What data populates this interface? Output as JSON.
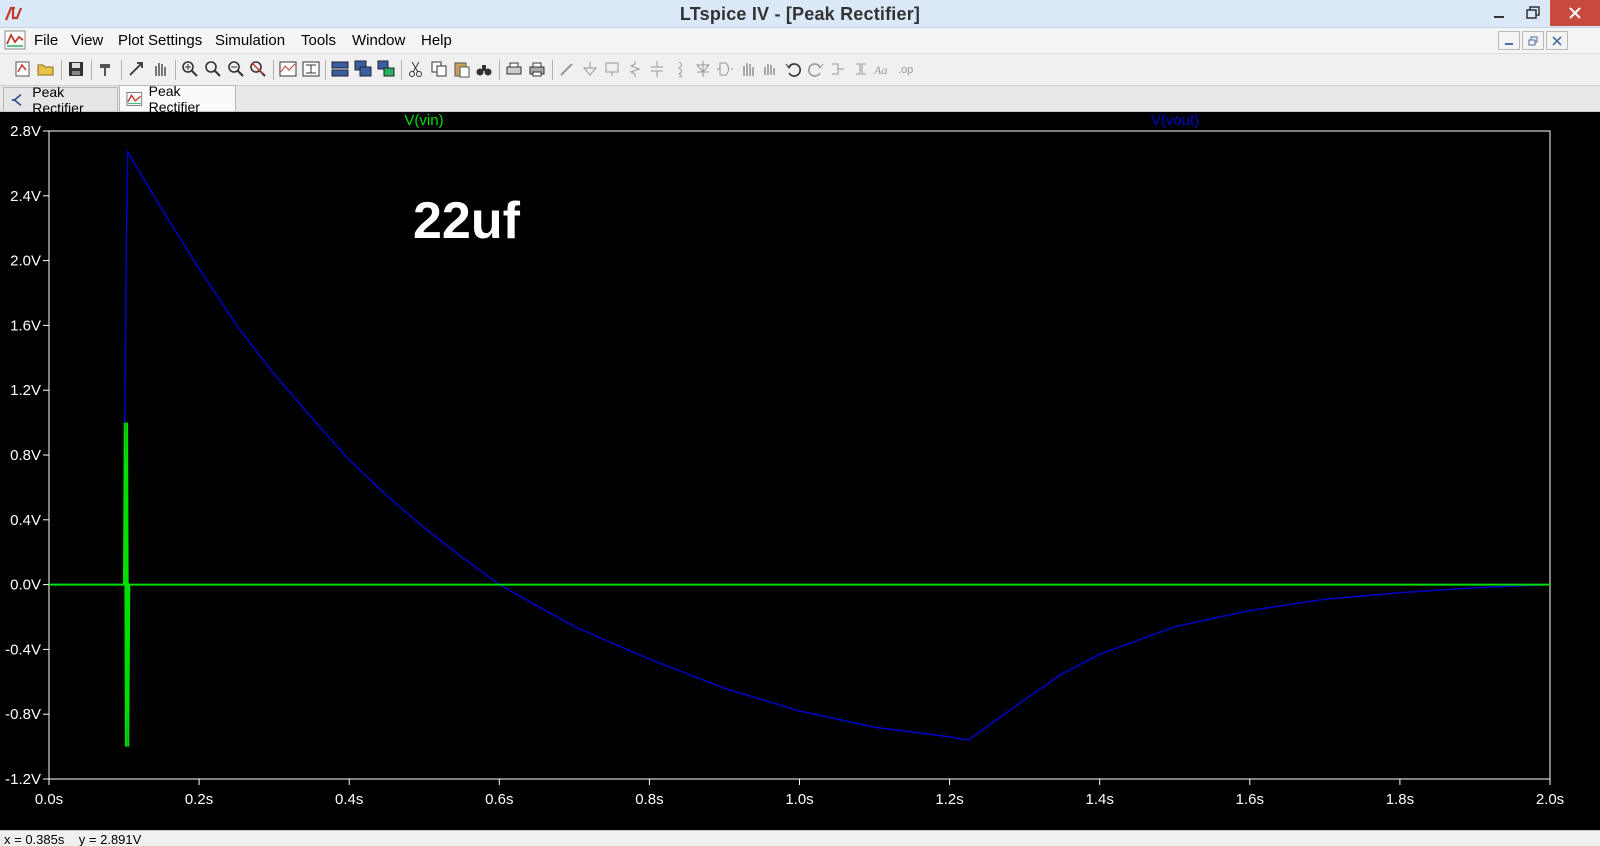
{
  "window": {
    "title": "LTspice IV - [Peak Rectifier]"
  },
  "menu": {
    "items": [
      "File",
      "View",
      "Plot Settings",
      "Simulation",
      "Tools",
      "Window",
      "Help"
    ]
  },
  "tabs": [
    {
      "label": "Peak Rectifier",
      "kind": "schematic"
    },
    {
      "label": "Peak Rectifier",
      "kind": "waveform",
      "active": true
    }
  ],
  "annotation": {
    "text": "22uf"
  },
  "status": {
    "text": "x = 0.385s    y = 2.891V"
  },
  "colors": {
    "background": "#000000",
    "vin": "#00e000",
    "vout": "#0000c8",
    "grid_frame": "#ffffff",
    "tick_labels": "#ffffff"
  },
  "chart_data": {
    "type": "line",
    "title": "",
    "xlabel": "",
    "ylabel": "",
    "x_ticks": [
      "0.0s",
      "0.2s",
      "0.4s",
      "0.6s",
      "0.8s",
      "1.0s",
      "1.2s",
      "1.4s",
      "1.6s",
      "1.8s",
      "2.0s"
    ],
    "y_ticks": [
      "2.8V",
      "2.4V",
      "2.0V",
      "1.6V",
      "1.2V",
      "0.8V",
      "0.4V",
      "0.0V",
      "-0.4V",
      "-0.8V",
      "-1.2V"
    ],
    "xlim": [
      0.0,
      2.0
    ],
    "ylim": [
      -1.2,
      2.8
    ],
    "grid": false,
    "legend_placement": "top",
    "series": [
      {
        "name": "V(vin)",
        "color": "#00e000",
        "x": [
          0.0,
          0.1,
          0.101,
          0.1025,
          0.104,
          0.1055,
          0.107,
          0.108,
          0.2,
          0.6,
          1.0,
          1.4,
          2.0
        ],
        "y": [
          0.0,
          0.0,
          1.0,
          -1.0,
          1.0,
          -1.0,
          0.0,
          0.0,
          0.0,
          0.0,
          0.0,
          0.0,
          0.0
        ]
      },
      {
        "name": "V(vout)",
        "color": "#0000c8",
        "x": [
          0.0,
          0.1,
          0.101,
          0.103,
          0.105,
          0.15,
          0.2,
          0.25,
          0.3,
          0.35,
          0.4,
          0.45,
          0.5,
          0.55,
          0.6,
          0.65,
          0.7,
          0.8,
          0.9,
          1.0,
          1.1,
          1.2,
          1.225,
          1.3,
          1.35,
          1.4,
          1.5,
          1.6,
          1.7,
          1.8,
          1.9,
          2.0
        ],
        "y": [
          0.0,
          0.0,
          1.0,
          2.1,
          2.67,
          2.32,
          1.95,
          1.6,
          1.3,
          1.03,
          0.77,
          0.55,
          0.35,
          0.17,
          0.0,
          -0.13,
          -0.26,
          -0.46,
          -0.64,
          -0.78,
          -0.88,
          -0.94,
          -0.96,
          -0.71,
          -0.55,
          -0.43,
          -0.26,
          -0.16,
          -0.09,
          -0.05,
          -0.02,
          0.0
        ]
      }
    ]
  }
}
